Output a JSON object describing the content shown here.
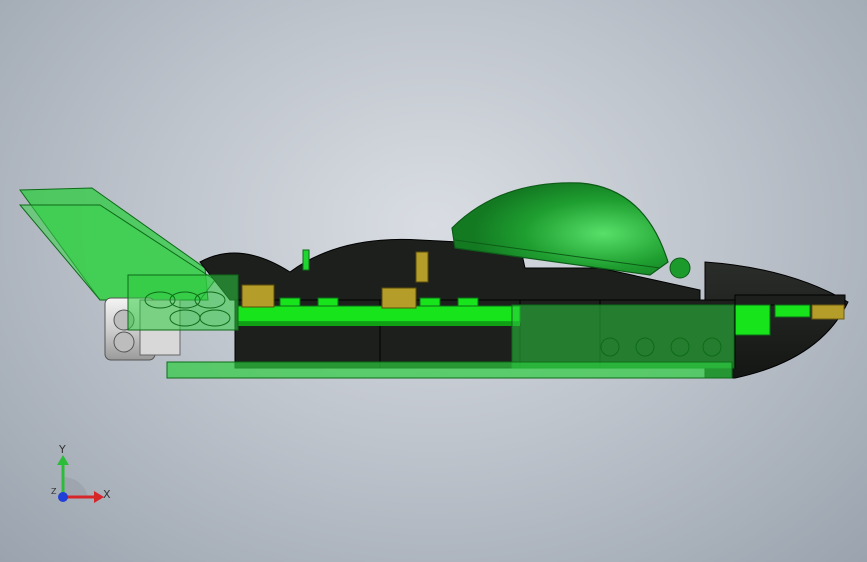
{
  "scene": {
    "model_name": "green-lego-spaceship",
    "view": "side-orthographic",
    "background_color": "#b7bec7",
    "colors": {
      "body_dark": "#1c1f1c",
      "brick_green": "#18e41c",
      "transparent_green": "#2ecc40",
      "canopy_green": "#1d9a2c",
      "stud_gold": "#b59d2a",
      "engine_white": "#e8e8e8"
    }
  },
  "triad": {
    "x_label": "X",
    "y_label": "Y",
    "z_label": "Z",
    "x_color": "#d6262a",
    "y_color": "#2bbd3a",
    "z_color": "#1f3fd6"
  }
}
